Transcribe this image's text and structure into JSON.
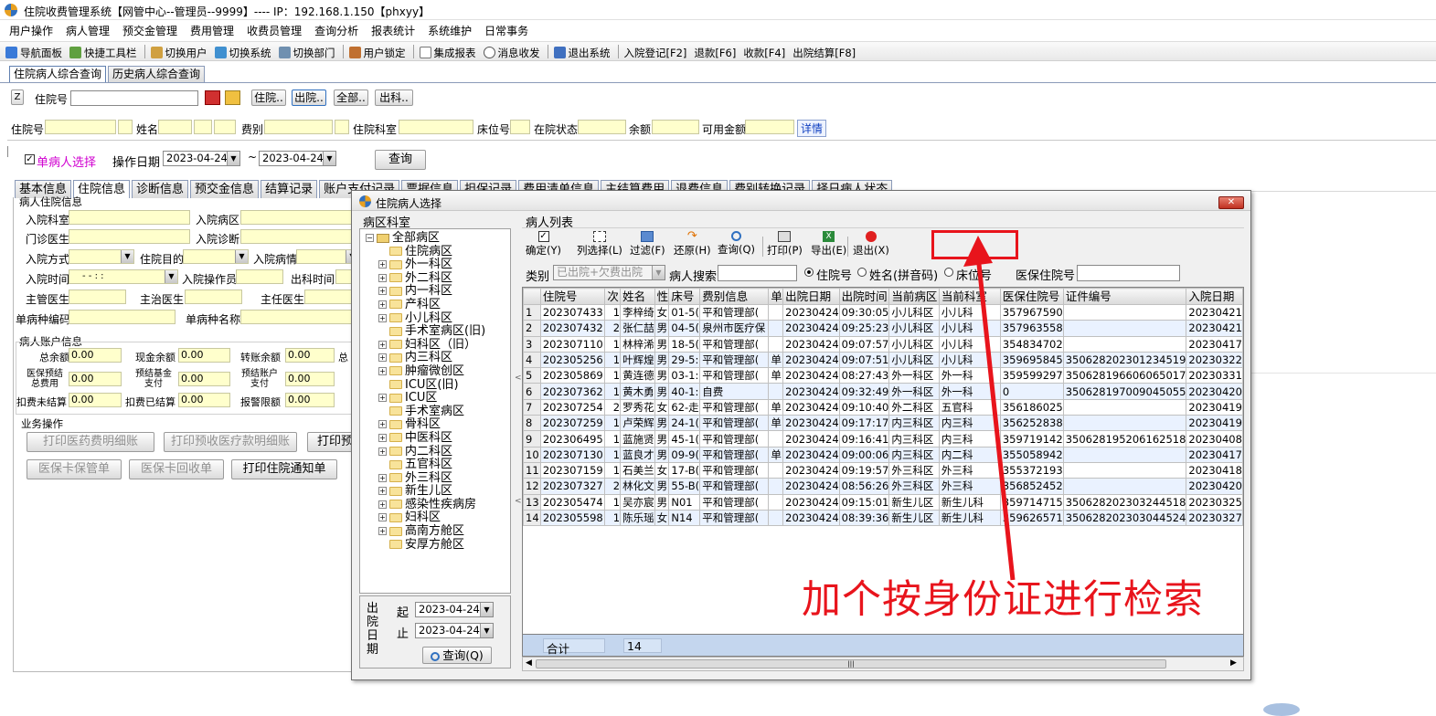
{
  "title": "住院收费管理系统【网管中心--管理员--9999】---- IP：192.168.1.150【phxyy】",
  "menu": [
    "用户操作",
    "病人管理",
    "预交金管理",
    "费用管理",
    "收费员管理",
    "查询分析",
    "报表统计",
    "系统维护",
    "日常事务"
  ],
  "toolbar": [
    "导航面板",
    "快捷工具栏",
    "切换用户",
    "切换系统",
    "切换部门",
    "用户锁定",
    "集成报表",
    "消息收发",
    "退出系统",
    "入院登记[F2]",
    "退款[F6]",
    "收款[F4]",
    "出院结算[F8]"
  ],
  "doc_tabs": [
    "住院病人综合查询",
    "历史病人综合查询"
  ],
  "search": {
    "label": "住院号",
    "buttons": [
      "住院..",
      "出院..",
      "全部..",
      "出科.."
    ]
  },
  "info_labels": {
    "zyh": "住院号",
    "xm": "姓名",
    "fb": "费别",
    "zyks": "住院科室",
    "cwh": "床位号",
    "zyzt": "在院状态",
    "ye": "余额",
    "kyje": "可用金额",
    "detail": "详情"
  },
  "filter": {
    "single": "单病人选择",
    "opdate": "操作日期",
    "from": "2023-04-24",
    "tilde": "~",
    "to": "2023-04-24",
    "query": "查询"
  },
  "inner_tabs": [
    "基本信息",
    "住院信息",
    "诊断信息",
    "预交金信息",
    "结算记录",
    "账户支付记录",
    "票据信息",
    "担保记录",
    "费用清单信息",
    "主结算费用",
    "退费信息",
    "费别转换记录",
    "择日病人状态"
  ],
  "left_form": {
    "section1": "病人住院信息",
    "l1": "入院科室",
    "l2": "入院病区",
    "l3": "门诊医生",
    "l4": "入院诊断",
    "l5": "入院方式",
    "l6": "住院目的",
    "l7": "入院病情",
    "l8": "入院时间",
    "time_ph": "-  -    :  :",
    "l9": "入院操作员",
    "l10": "出科时间",
    "l11": "主管医生",
    "l12": "主治医生",
    "l13": "主任医生",
    "l14": "单病种编码",
    "l15": "单病种名称",
    "section2": "病人账户信息",
    "a1": "总余额",
    "a2": "现金余额",
    "a3": "转账余额",
    "a3b": "总",
    "a4": "医保预结\n总费用",
    "a5": "预结基金\n支付",
    "a6": "预结账户\n支付",
    "a7": "扣费未结算",
    "a8": "扣费已结算",
    "a9": "报警限额",
    "zero": "0.00",
    "section3": "业务操作",
    "b1": "打印医药费明细账",
    "b2": "打印预收医疗款明细账",
    "b3": "打印预",
    "b4": "医保卡保管单",
    "b5": "医保卡回收单",
    "b6": "打印住院通知单"
  },
  "dialog": {
    "title": "住院病人选择",
    "area_label": "病区科室",
    "list_label": "病人列表",
    "tree": [
      "全部病区",
      "住院病区",
      "外一科区",
      "外二科区",
      "内一科区",
      "产科区",
      "小儿科区",
      "手术室病区(旧)",
      "妇科区（旧）",
      "内三科区",
      "肿瘤微创区",
      "ICU区(旧)",
      "ICU区",
      "手术室病区",
      "骨科区",
      "中医科区",
      "内二科区",
      "五官科区",
      "外三科区",
      "新生儿区",
      "感染性疾病房",
      "妇科区",
      "高南方舱区",
      "安厚方舱区"
    ],
    "tools": [
      "确定(Y)",
      "列选择(L)",
      "过滤(F)",
      "还原(H)",
      "查询(Q)",
      "打印(P)",
      "导出(E)",
      "退出(X)"
    ],
    "type_label": "类别",
    "type_value": "已出院+欠费出院",
    "psearch": "病人搜索",
    "radios": [
      "住院号",
      "姓名(拼音码)",
      "床位号"
    ],
    "yb": "医保住院号",
    "cy_label": "出院日期",
    "from_l": "起",
    "to_l": "止",
    "from": "2023-04-24",
    "to": "2023-04-24",
    "query": "查询(Q)",
    "total_label": "合计",
    "total": "14",
    "columns": [
      "",
      "住院号",
      "次",
      "姓名",
      "性",
      "床号",
      "费别信息",
      "单",
      "出院日期",
      "出院时间",
      "当前病区",
      "当前科室",
      "医保住院号",
      "证件编号",
      "入院日期"
    ],
    "rows": [
      [
        "1",
        "202307433",
        "1",
        "李梓绮",
        "女",
        "01-5(",
        "平和管理部(",
        "",
        "20230424",
        "09:30:05",
        "小儿科区",
        "小儿科",
        "357967590",
        "",
        "20230421"
      ],
      [
        "2",
        "202307432",
        "2",
        "张仁喆",
        "男",
        "04-5(",
        "泉州市医疗保",
        "",
        "20230424",
        "09:25:23",
        "小儿科区",
        "小儿科",
        "357963558",
        "",
        "20230421"
      ],
      [
        "3",
        "202307110",
        "1",
        "林梓浠",
        "男",
        "18-5(",
        "平和管理部(",
        "",
        "20230424",
        "09:07:57",
        "小儿科区",
        "小儿科",
        "354834702",
        "",
        "20230417"
      ],
      [
        "4",
        "202305256",
        "1",
        "叶辉煌",
        "男",
        "29-5:",
        "平和管理部(",
        "单",
        "20230424",
        "09:07:51",
        "小儿科区",
        "小儿科",
        "359695845",
        "350628202301234519",
        "20230322"
      ],
      [
        "5",
        "202305869",
        "1",
        "黄连德",
        "男",
        "03-1:",
        "平和管理部(",
        "单",
        "20230424",
        "08:27:43",
        "外一科区",
        "外一科",
        "359599297",
        "350628196606065017",
        "20230331"
      ],
      [
        "6",
        "202307362",
        "1",
        "黄木勇",
        "男",
        "40-1:",
        "自费",
        "",
        "20230424",
        "09:32:49",
        "外一科区",
        "外一科",
        "0",
        "350628197009045055",
        "20230420"
      ],
      [
        "7",
        "202307254",
        "2",
        "罗秀花",
        "女",
        "62-走",
        "平和管理部(",
        "单",
        "20230424",
        "09:10:40",
        "外二科区",
        "五官科",
        "356186025",
        "",
        "20230419"
      ],
      [
        "8",
        "202307259",
        "1",
        "卢荣辉",
        "男",
        "24-1(",
        "平和管理部(",
        "单",
        "20230424",
        "09:17:17",
        "内三科区",
        "内三科",
        "356252838",
        "",
        "20230419"
      ],
      [
        "9",
        "202306495",
        "1",
        "蓝施贤",
        "男",
        "45-1(",
        "平和管理部(",
        "",
        "20230424",
        "09:16:41",
        "内三科区",
        "内三科",
        "359719142",
        "350628195206162518",
        "20230408"
      ],
      [
        "10",
        "202307130",
        "1",
        "蓝良才",
        "男",
        "09-9(",
        "平和管理部(",
        "单",
        "20230424",
        "09:00:06",
        "内三科区",
        "内二科",
        "355058942",
        "",
        "20230417"
      ],
      [
        "11",
        "202307159",
        "1",
        "石美兰",
        "女",
        "17-B(",
        "平和管理部(",
        "",
        "20230424",
        "09:19:57",
        "外三科区",
        "外三科",
        "355372193",
        "",
        "20230418"
      ],
      [
        "12",
        "202307327",
        "2",
        "林化文",
        "男",
        "55-B(",
        "平和管理部(",
        "",
        "20230424",
        "08:56:26",
        "外三科区",
        "外三科",
        "356852452",
        "",
        "20230420"
      ],
      [
        "13",
        "202305474",
        "1",
        "吴亦宸",
        "男",
        "N01",
        "平和管理部(",
        "",
        "20230424",
        "09:15:01",
        "新生儿区",
        "新生儿科",
        "359714715",
        "350628202303244518",
        "20230325"
      ],
      [
        "14",
        "202305598",
        "1",
        "陈乐瑶",
        "女",
        "N14",
        "平和管理部(",
        "",
        "20230424",
        "08:39:36",
        "新生儿区",
        "新生儿科",
        "359626571",
        "350628202303044524",
        "20230327"
      ]
    ]
  },
  "annotation": "加个按身份证进行检索",
  "colors": {
    "annotation": "#e8141c",
    "yellow": "#ffffcc",
    "title_bar": "#fff"
  }
}
